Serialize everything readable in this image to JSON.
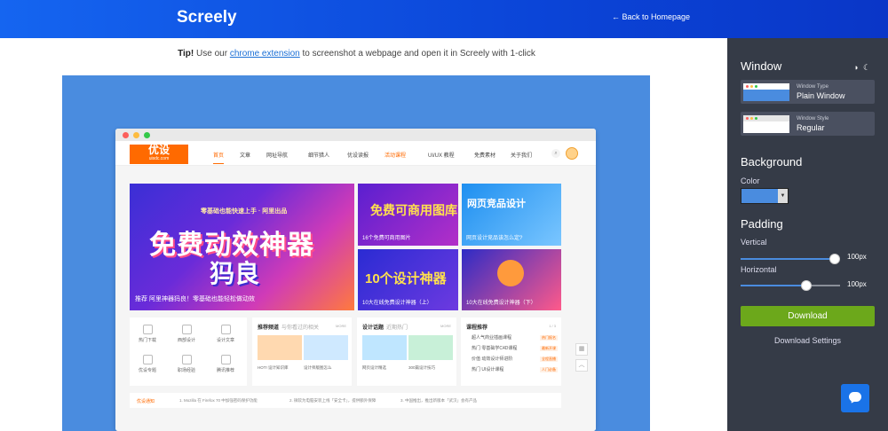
{
  "header": {
    "logo": "Screely",
    "back_link": "← Back to Homepage"
  },
  "tip": {
    "bold": "Tip!",
    "pre": " Use our ",
    "link": "chrome extension",
    "post": " to screenshot a webpage and open it in Screely with 1-click"
  },
  "preview": {
    "background_color": "#4a8cdf",
    "site_logo": "优设",
    "site_logo_sub": "uisdc.com",
    "nav": [
      "首页",
      "文章",
      "网址导航",
      "细节猎人",
      "优设读报",
      "活动课程",
      "UI/UX 教程",
      "免费素材",
      "关于我们"
    ],
    "hero": {
      "line1": "零基础也能快速上手 · 阿里出品",
      "line2": "免费动效神器",
      "line3": "犸良",
      "caption": "推荐 阿里神器犸良！零基础也能轻松做动效"
    },
    "tiles": [
      {
        "big": "免费可商用图库",
        "caption": "16个免费可商用图片"
      },
      {
        "big": "网页竞品设计",
        "caption": "网页设计竞品该怎么定?"
      },
      {
        "big": "10个设计神器",
        "caption": "10大在线免费设计神器（上）"
      },
      {
        "big": "",
        "caption": "10大在线免费设计神器（下）"
      }
    ],
    "categories": [
      "热门下载",
      "西部设计",
      "设计文章",
      "优设专题",
      "职场经验",
      "腾讯推荐"
    ],
    "card2": {
      "title": "推荐频道",
      "sub": "与你看过的相关",
      "more": "MORE",
      "items": [
        "HOT! 设计知识库",
        "设计师版图怎么"
      ]
    },
    "card3": {
      "title": "设计话题",
      "sub": "近期热门",
      "more": "MORE",
      "items": [
        "网页设计精选",
        "300篇设计技巧"
      ]
    },
    "card4": {
      "title": "课程推荐",
      "pager": "1 / 3",
      "items": [
        "超人气商业插画课程",
        "热门 零基础学C4D课程",
        "价值 动效设计师进阶",
        "热门 UI设计课程"
      ],
      "tags": [
        "热门报名",
        "最新开课",
        "全程直播",
        "人门必备"
      ]
    },
    "notice": {
      "label": "优设通知",
      "items": [
        "1. Mozilla 在 Firefox 70 中加强密码保护功能",
        "2. 微软为电脑安装上线「安全卡」，提供额外保障",
        "3. 中国推出，推出新版本「武汉」会有产品"
      ]
    }
  },
  "panel": {
    "window_heading": "Window",
    "window_type_label": "Window Type",
    "window_type_value": "Plain Window",
    "window_style_label": "Window Style",
    "window_style_value": "Regular",
    "background_heading": "Background",
    "color_label": "Color",
    "color_value": "#4a8cdf",
    "padding_heading": "Padding",
    "vertical_label": "Vertical",
    "vertical_value": "100px",
    "vertical_fraction": 0.95,
    "horizontal_label": "Horizontal",
    "horizontal_value": "100px",
    "horizontal_fraction": 0.66,
    "download_label": "Download",
    "download_settings_label": "Download Settings"
  }
}
